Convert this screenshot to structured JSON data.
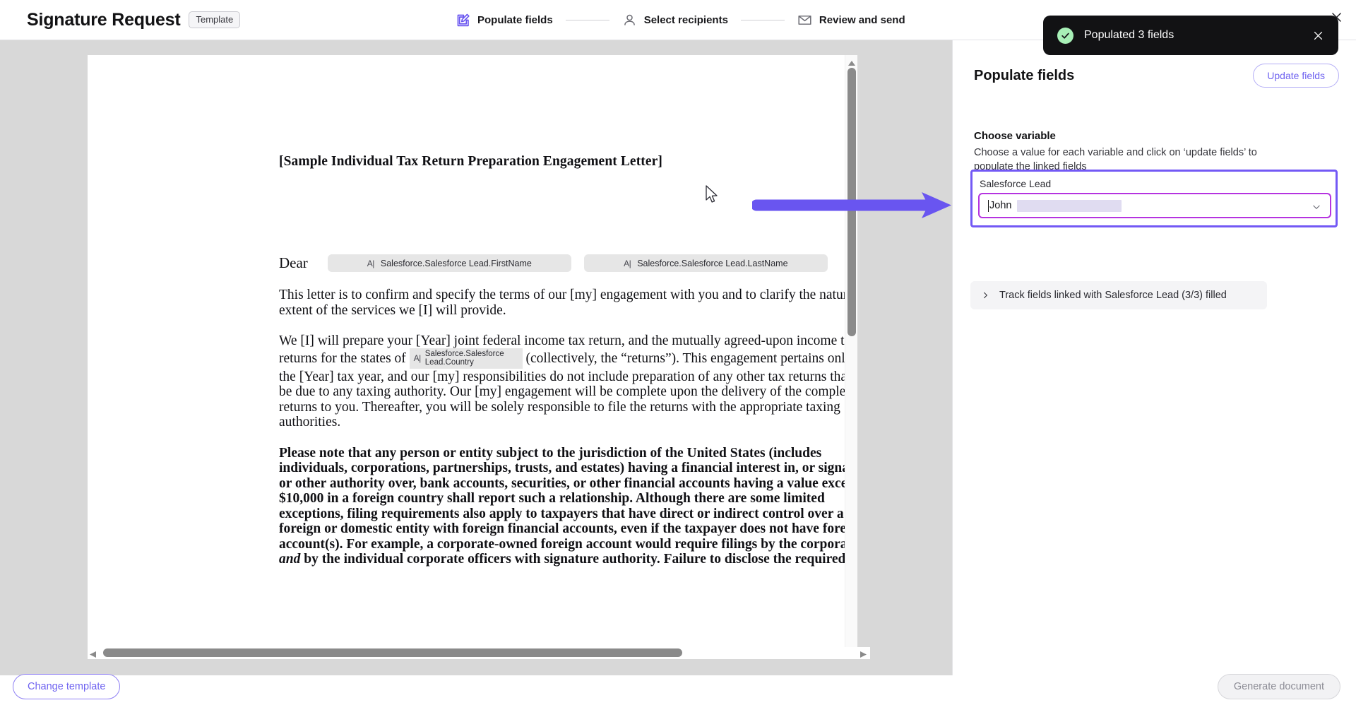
{
  "header": {
    "title": "Signature Request",
    "template_chip": "Template",
    "steps": [
      {
        "label": "Populate fields",
        "icon": "edit-square-icon",
        "active": true
      },
      {
        "label": "Select recipients",
        "icon": "person-icon",
        "active": false
      },
      {
        "label": "Review and send",
        "icon": "envelope-icon",
        "active": false
      }
    ],
    "close_icon": "close-icon"
  },
  "toast": {
    "message": "Populated 3 fields",
    "status_icon": "check-circle-icon",
    "close_icon": "close-icon",
    "background": "#121214",
    "check_color": "#a8f0b7"
  },
  "document": {
    "title": "[Sample Individual Tax Return Preparation Engagement Letter]",
    "salutation": "Dear",
    "salutation_fields": [
      {
        "icon": "text-field-icon",
        "label": "Salesforce.Salesforce Lead.FirstName"
      },
      {
        "icon": "text-field-icon",
        "label": "Salesforce.Salesforce Lead.LastName"
      }
    ],
    "paragraph_1": "This letter is to confirm and specify the terms of our [my] engagement with you and to clarify the nature and extent of the services we [I] will provide.",
    "paragraph_2_pre": "We [I] will prepare your [Year] joint federal income tax return, and the mutually agreed-upon income tax returns for the states of ",
    "paragraph_2_field": "Salesforce.Salesforce Lead.Country",
    "paragraph_2_post": " (collectively, the “returns”).  This engagement pertains only to the [Year] tax year, and our [my] responsibilities do not include preparation of any other tax returns that may be due to any taxing authority.  Our [my] engagement will be complete upon the delivery of the completed returns to you.  Thereafter, you will be solely responsible to file the returns with the appropriate taxing authorities.",
    "paragraph_3_a": "Please note that any person or entity subject to the jurisdiction of the United States (includes individuals, corporations, partnerships, trusts, and estates) having a financial interest in, or signature or other authority over, bank accounts, securities, or other financial accounts having a value exceeding $10,000 in a foreign country shall report such a relationship. Although there are some limited exceptions, filing requirements also apply to taxpayers that have direct or indirect control over a foreign or domestic entity with foreign financial accounts, even if the taxpayer does not have foreign account(s). For example, a corporate-owned foreign account would require filings by the corporation ",
    "paragraph_3_em": "and",
    "paragraph_3_b": " by the individual corporate officers with signature authority. Failure to disclose the required"
  },
  "right_panel": {
    "title": "Populate fields",
    "update_fields_label": "Update fields",
    "section_title": "Choose variable",
    "section_desc": "Choose a value for each variable and click on ‘update fields’ to populate the linked fields",
    "variable": {
      "label": "Salesforce Lead",
      "value": "John",
      "chevron_icon": "chevron-down-icon",
      "highlight_border": "#7359f5",
      "field_border": "#b533e0"
    },
    "track_row": {
      "label": "Track fields linked with Salesforce Lead (3/3) filled",
      "chevron_icon": "chevron-right-icon"
    }
  },
  "footer": {
    "change_template_label": "Change template",
    "generate_document_label": "Generate document"
  },
  "annotation": {
    "arrow_color": "#6955f0",
    "arrow_icon": "right-arrow-annotation"
  },
  "scrollbars": {
    "vertical_up_icon": "scroll-up-arrow-icon",
    "vertical_down_icon": "scroll-down-arrow-icon",
    "horizontal_left_icon": "scroll-left-arrow-icon",
    "horizontal_right_icon": "scroll-right-arrow-icon"
  }
}
